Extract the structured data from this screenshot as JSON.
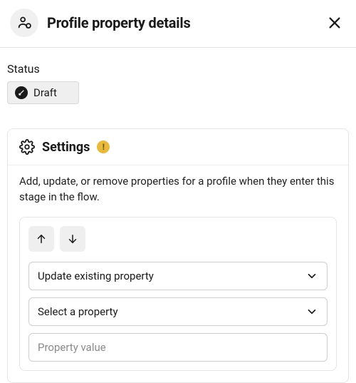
{
  "header": {
    "title": "Profile property details"
  },
  "status": {
    "label": "Status",
    "value": "Draft"
  },
  "settings": {
    "title": "Settings",
    "warning_glyph": "!",
    "description": "Add, update, or remove properties for a profile when they enter this stage in the flow.",
    "rule": {
      "action_select": "Update existing property",
      "property_select": "Select a property",
      "value_placeholder": "Property value"
    }
  }
}
